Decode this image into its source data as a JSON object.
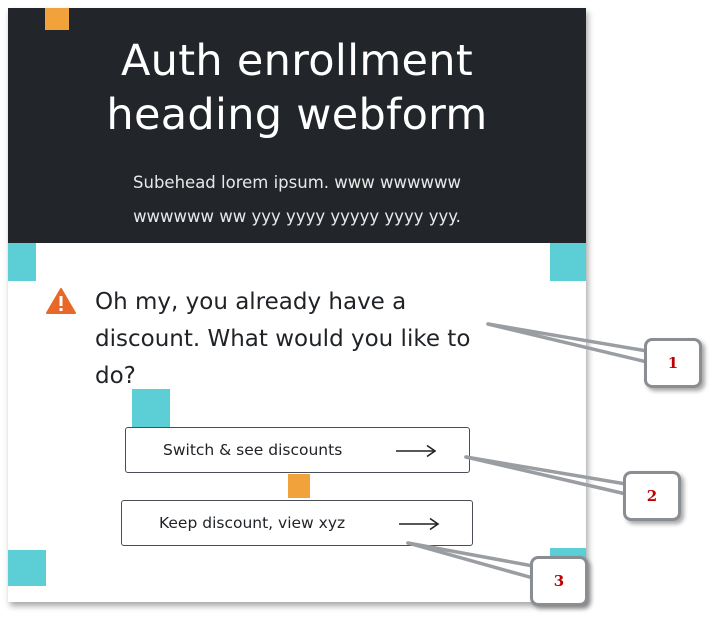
{
  "hero": {
    "title_line1": "Auth enrollment",
    "title_line2": "heading webform",
    "subhead_line1": "Subehead lorem ipsum. www wwwwww",
    "subhead_line2": "wwwwww ww yyy yyyy yyyyy yyyy yyy."
  },
  "alert": {
    "icon": "warning-triangle-icon",
    "line1": "Oh my, you already have a",
    "line2": "discount.  What would you like to",
    "line3": "do?"
  },
  "buttons": {
    "switch_label": "Switch & see discounts",
    "keep_label": "Keep discount, view xyz",
    "arrow_icon": "long-arrow-right-icon"
  },
  "callouts": [
    "1",
    "2",
    "3"
  ],
  "colors": {
    "hero_bg": "#22262a",
    "accent_orange": "#f2a23b",
    "accent_teal": "#5bcfd5",
    "warning": "#e8682a",
    "callout_text": "#c00000"
  }
}
